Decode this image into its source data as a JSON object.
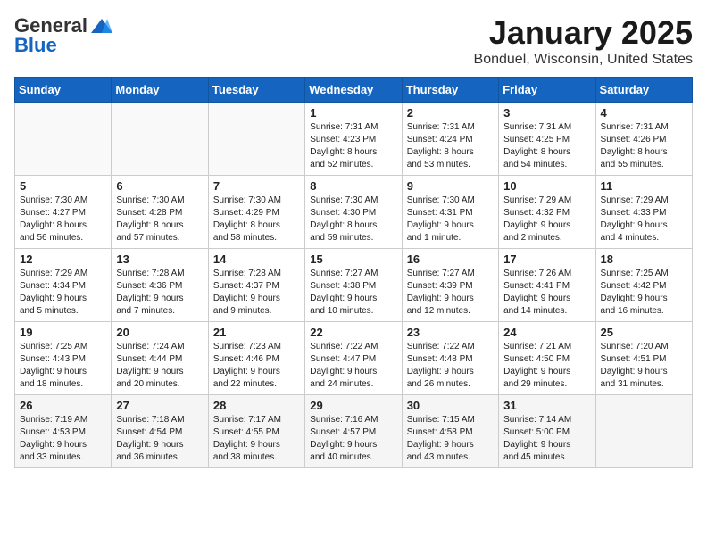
{
  "header": {
    "logo_general": "General",
    "logo_blue": "Blue",
    "month_title": "January 2025",
    "location": "Bonduel, Wisconsin, United States"
  },
  "days_of_week": [
    "Sunday",
    "Monday",
    "Tuesday",
    "Wednesday",
    "Thursday",
    "Friday",
    "Saturday"
  ],
  "weeks": [
    [
      {
        "day": "",
        "info": ""
      },
      {
        "day": "",
        "info": ""
      },
      {
        "day": "",
        "info": ""
      },
      {
        "day": "1",
        "info": "Sunrise: 7:31 AM\nSunset: 4:23 PM\nDaylight: 8 hours\nand 52 minutes."
      },
      {
        "day": "2",
        "info": "Sunrise: 7:31 AM\nSunset: 4:24 PM\nDaylight: 8 hours\nand 53 minutes."
      },
      {
        "day": "3",
        "info": "Sunrise: 7:31 AM\nSunset: 4:25 PM\nDaylight: 8 hours\nand 54 minutes."
      },
      {
        "day": "4",
        "info": "Sunrise: 7:31 AM\nSunset: 4:26 PM\nDaylight: 8 hours\nand 55 minutes."
      }
    ],
    [
      {
        "day": "5",
        "info": "Sunrise: 7:30 AM\nSunset: 4:27 PM\nDaylight: 8 hours\nand 56 minutes."
      },
      {
        "day": "6",
        "info": "Sunrise: 7:30 AM\nSunset: 4:28 PM\nDaylight: 8 hours\nand 57 minutes."
      },
      {
        "day": "7",
        "info": "Sunrise: 7:30 AM\nSunset: 4:29 PM\nDaylight: 8 hours\nand 58 minutes."
      },
      {
        "day": "8",
        "info": "Sunrise: 7:30 AM\nSunset: 4:30 PM\nDaylight: 8 hours\nand 59 minutes."
      },
      {
        "day": "9",
        "info": "Sunrise: 7:30 AM\nSunset: 4:31 PM\nDaylight: 9 hours\nand 1 minute."
      },
      {
        "day": "10",
        "info": "Sunrise: 7:29 AM\nSunset: 4:32 PM\nDaylight: 9 hours\nand 2 minutes."
      },
      {
        "day": "11",
        "info": "Sunrise: 7:29 AM\nSunset: 4:33 PM\nDaylight: 9 hours\nand 4 minutes."
      }
    ],
    [
      {
        "day": "12",
        "info": "Sunrise: 7:29 AM\nSunset: 4:34 PM\nDaylight: 9 hours\nand 5 minutes."
      },
      {
        "day": "13",
        "info": "Sunrise: 7:28 AM\nSunset: 4:36 PM\nDaylight: 9 hours\nand 7 minutes."
      },
      {
        "day": "14",
        "info": "Sunrise: 7:28 AM\nSunset: 4:37 PM\nDaylight: 9 hours\nand 9 minutes."
      },
      {
        "day": "15",
        "info": "Sunrise: 7:27 AM\nSunset: 4:38 PM\nDaylight: 9 hours\nand 10 minutes."
      },
      {
        "day": "16",
        "info": "Sunrise: 7:27 AM\nSunset: 4:39 PM\nDaylight: 9 hours\nand 12 minutes."
      },
      {
        "day": "17",
        "info": "Sunrise: 7:26 AM\nSunset: 4:41 PM\nDaylight: 9 hours\nand 14 minutes."
      },
      {
        "day": "18",
        "info": "Sunrise: 7:25 AM\nSunset: 4:42 PM\nDaylight: 9 hours\nand 16 minutes."
      }
    ],
    [
      {
        "day": "19",
        "info": "Sunrise: 7:25 AM\nSunset: 4:43 PM\nDaylight: 9 hours\nand 18 minutes."
      },
      {
        "day": "20",
        "info": "Sunrise: 7:24 AM\nSunset: 4:44 PM\nDaylight: 9 hours\nand 20 minutes."
      },
      {
        "day": "21",
        "info": "Sunrise: 7:23 AM\nSunset: 4:46 PM\nDaylight: 9 hours\nand 22 minutes."
      },
      {
        "day": "22",
        "info": "Sunrise: 7:22 AM\nSunset: 4:47 PM\nDaylight: 9 hours\nand 24 minutes."
      },
      {
        "day": "23",
        "info": "Sunrise: 7:22 AM\nSunset: 4:48 PM\nDaylight: 9 hours\nand 26 minutes."
      },
      {
        "day": "24",
        "info": "Sunrise: 7:21 AM\nSunset: 4:50 PM\nDaylight: 9 hours\nand 29 minutes."
      },
      {
        "day": "25",
        "info": "Sunrise: 7:20 AM\nSunset: 4:51 PM\nDaylight: 9 hours\nand 31 minutes."
      }
    ],
    [
      {
        "day": "26",
        "info": "Sunrise: 7:19 AM\nSunset: 4:53 PM\nDaylight: 9 hours\nand 33 minutes."
      },
      {
        "day": "27",
        "info": "Sunrise: 7:18 AM\nSunset: 4:54 PM\nDaylight: 9 hours\nand 36 minutes."
      },
      {
        "day": "28",
        "info": "Sunrise: 7:17 AM\nSunset: 4:55 PM\nDaylight: 9 hours\nand 38 minutes."
      },
      {
        "day": "29",
        "info": "Sunrise: 7:16 AM\nSunset: 4:57 PM\nDaylight: 9 hours\nand 40 minutes."
      },
      {
        "day": "30",
        "info": "Sunrise: 7:15 AM\nSunset: 4:58 PM\nDaylight: 9 hours\nand 43 minutes."
      },
      {
        "day": "31",
        "info": "Sunrise: 7:14 AM\nSunset: 5:00 PM\nDaylight: 9 hours\nand 45 minutes."
      },
      {
        "day": "",
        "info": ""
      }
    ]
  ]
}
